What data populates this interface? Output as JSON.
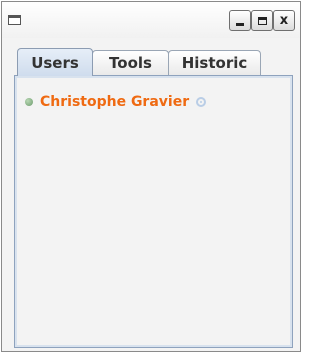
{
  "window": {
    "controls": {
      "minimize_icon": "minimize-icon",
      "maximize_icon": "maximize-icon",
      "close_label": "x"
    }
  },
  "tabs": [
    {
      "label": "Users",
      "active": true
    },
    {
      "label": "Tools",
      "active": false
    },
    {
      "label": "Historic",
      "active": false
    }
  ],
  "users": [
    {
      "name": "Christophe Gravier",
      "status": "online",
      "status_color": "#6b9a6b",
      "name_color": "#ef6a12"
    }
  ]
}
